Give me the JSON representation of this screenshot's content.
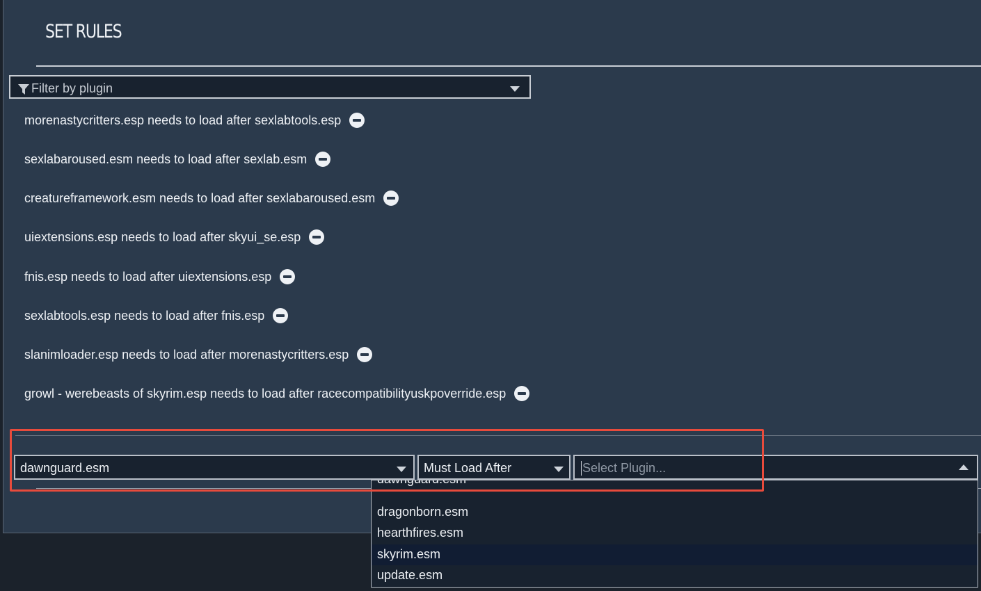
{
  "dialog": {
    "title": "SET RULES"
  },
  "filter": {
    "placeholder": "Filter by plugin",
    "icon": "funnel-icon"
  },
  "rules": [
    {
      "text": "morenastycritters.esp needs to load after sexlabtools.esp"
    },
    {
      "text": "sexlabaroused.esm needs to load after sexlab.esm"
    },
    {
      "text": "creatureframework.esm needs to load after sexlabaroused.esm"
    },
    {
      "text": "uiextensions.esp needs to load after skyui_se.esp"
    },
    {
      "text": "fnis.esp needs to load after uiextensions.esp"
    },
    {
      "text": "sexlabtools.esp needs to load after fnis.esp"
    },
    {
      "text": "slanimloader.esp needs to load after morenastycritters.esp"
    },
    {
      "text": "growl - werebeasts of skyrim.esp needs to load after racecompatibilityuskpoverride.esp"
    }
  ],
  "new_rule": {
    "source_plugin": "dawnguard.esm",
    "relation": "Must Load After",
    "target_placeholder": "Select Plugin..."
  },
  "dropdown": {
    "options": [
      "dawnguard.esm",
      "dragonborn.esm",
      "hearthfires.esm",
      "skyrim.esm",
      "update.esm"
    ],
    "highlighted": "skyrim.esm"
  },
  "colors": {
    "panel": "#2b3a4c",
    "field": "#18222f",
    "annotation": "#e84b3c"
  }
}
